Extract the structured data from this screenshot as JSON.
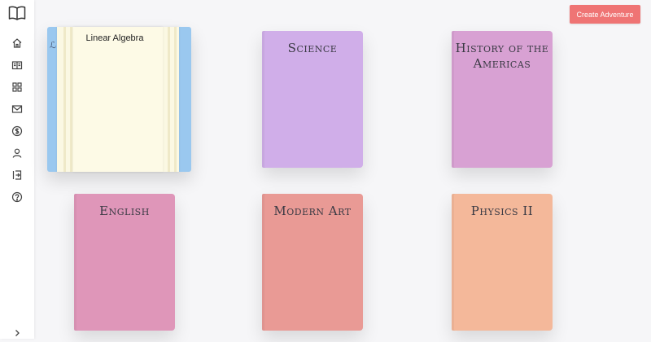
{
  "sidebar": {
    "logo_icon": "open-book-icon",
    "items": [
      {
        "icon": "home-icon"
      },
      {
        "icon": "book-icon"
      },
      {
        "icon": "grid-icon"
      },
      {
        "icon": "mail-icon"
      },
      {
        "icon": "dollar-icon"
      },
      {
        "icon": "user-icon"
      },
      {
        "icon": "logout-icon"
      },
      {
        "icon": "help-icon"
      }
    ],
    "expand_icon": "chevron-right-icon"
  },
  "header": {
    "create_button_label": "Create Adventure",
    "create_button_color": "#ef7474"
  },
  "open_book": {
    "title": "Linear Algebra",
    "cover_color": "#9ac8ef",
    "page_color": "#fbf8e3",
    "cover_glyph": "ℒ"
  },
  "books": [
    {
      "title": "Science",
      "color": "#d0aee9"
    },
    {
      "title": "History of the Americas",
      "color": "#d8a1d3"
    },
    {
      "title": "English",
      "color": "#df96b9"
    },
    {
      "title": "Modern Art",
      "color": "#e99a95"
    },
    {
      "title": "Physics II",
      "color": "#f4b89a"
    }
  ]
}
